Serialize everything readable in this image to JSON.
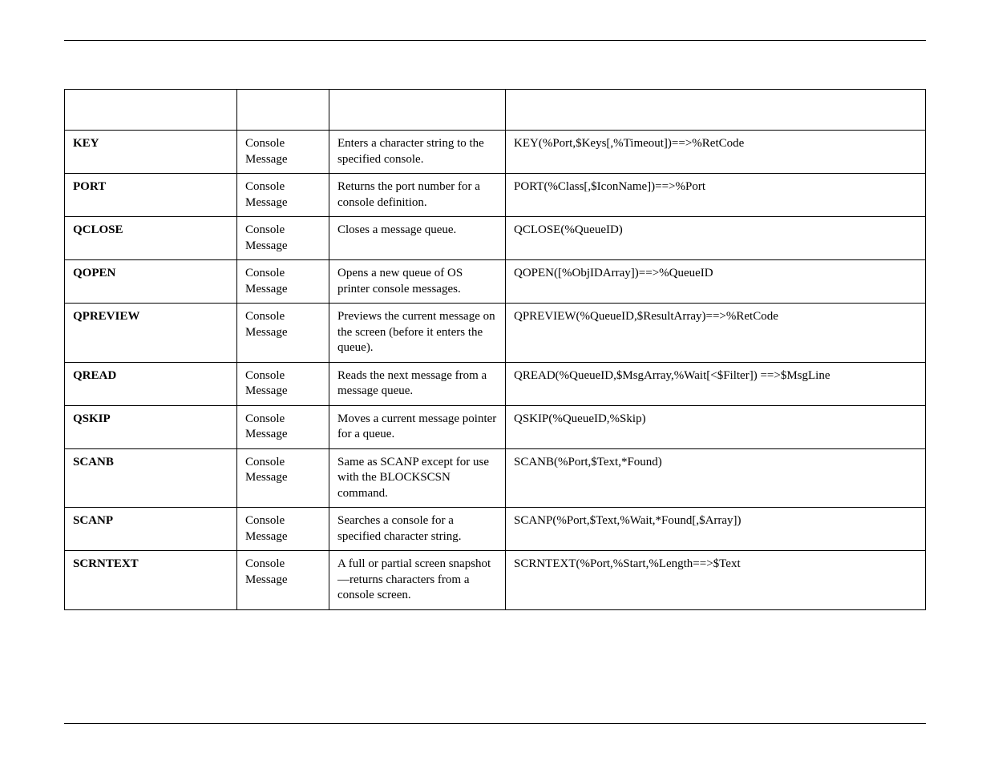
{
  "rows": [
    {
      "name": "KEY",
      "type": "Console Message",
      "desc": "Enters a character string to the specified console.",
      "syntax": "KEY(%Port,$Keys[,%Timeout])==>%RetCode"
    },
    {
      "name": "PORT",
      "type": "Console Message",
      "desc": "Returns the port number for a console definition.",
      "syntax": "PORT(%Class[,$IconName])==>%Port"
    },
    {
      "name": "QCLOSE",
      "type": "Console Message",
      "desc": "Closes a message queue.",
      "syntax": "QCLOSE(%QueueID)"
    },
    {
      "name": "QOPEN",
      "type": "Console Message",
      "desc": "Opens a new queue of OS printer console messages.",
      "syntax": "QOPEN([%ObjIDArray])==>%QueueID"
    },
    {
      "name": "QPREVIEW",
      "type": "Console Message",
      "desc": "Previews the current message on the screen (before it enters the queue).",
      "syntax": "QPREVIEW(%QueueID,$ResultArray)==>%RetCode"
    },
    {
      "name": "QREAD",
      "type": "Console Message",
      "desc": "Reads the next message from a message queue.",
      "syntax": "QREAD(%QueueID,$MsgArray,%Wait[<$Filter]) ==>$MsgLine"
    },
    {
      "name": "QSKIP",
      "type": "Console Message",
      "desc": "Moves a current message pointer for a queue.",
      "syntax": "QSKIP(%QueueID,%Skip)"
    },
    {
      "name": "SCANB",
      "type": "Console Message",
      "desc": "Same as SCANP except for use with the BLOCKSCSN command.",
      "syntax": "SCANB(%Port,$Text,*Found)"
    },
    {
      "name": "SCANP",
      "type": "Console Message",
      "desc": "Searches a console for a specified character string.",
      "syntax": "SCANP(%Port,$Text,%Wait,*Found[,$Array])"
    },
    {
      "name": "SCRNTEXT",
      "type": "Console Message",
      "desc": "A full or partial screen snapshot—returns characters from a console screen.",
      "syntax": "SCRNTEXT(%Port,%Start,%Length==>$Text"
    }
  ]
}
